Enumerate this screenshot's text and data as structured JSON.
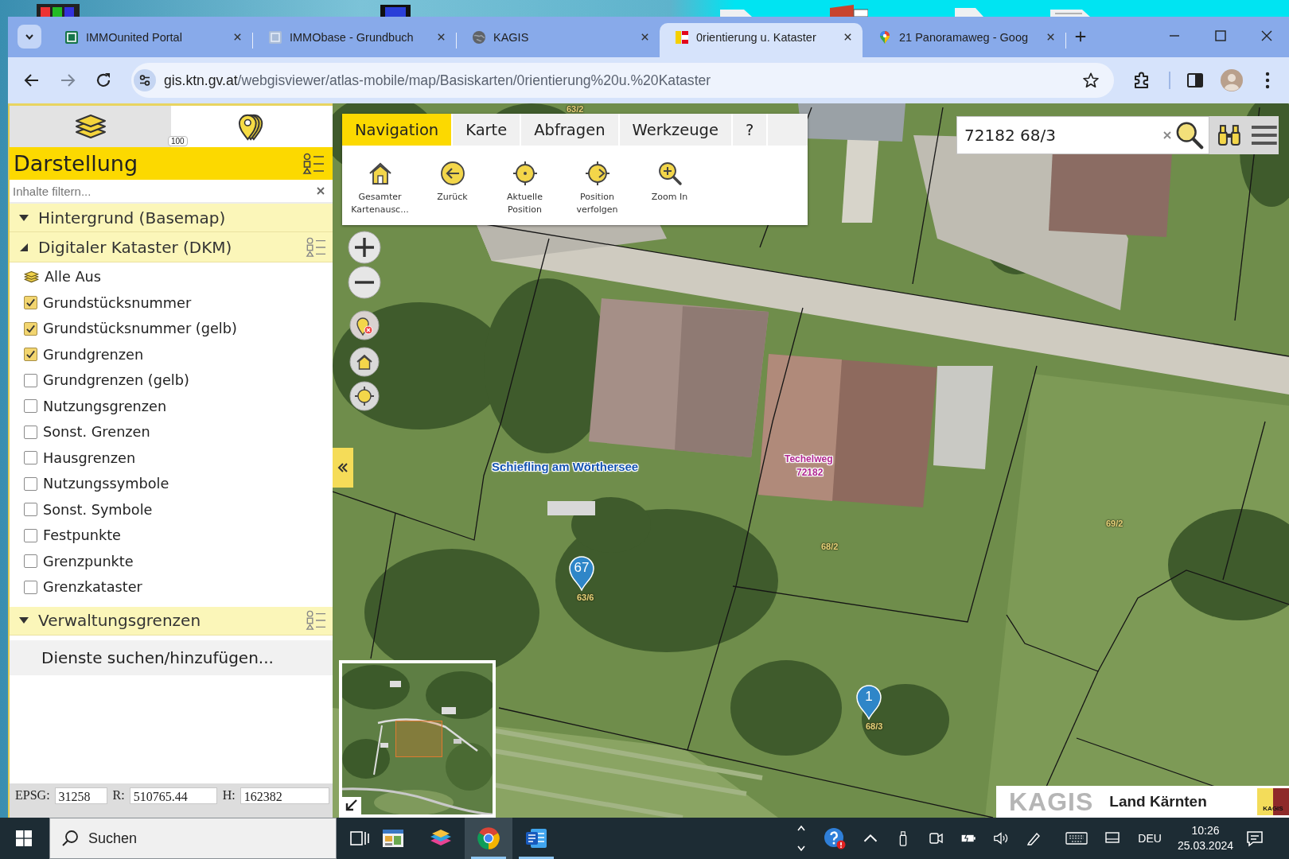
{
  "browser": {
    "tabs": [
      {
        "title": "IMMOunited Portal",
        "kind": "portal",
        "selected": false
      },
      {
        "title": "IMMObase - Grundbuch",
        "kind": "register",
        "selected": false
      },
      {
        "title": "KAGIS",
        "kind": "globe",
        "selected": false
      },
      {
        "title": "0rientierung u. Kataster",
        "kind": "flag",
        "selected": true
      },
      {
        "title": "21 Panoramaweg - Goog",
        "kind": "pin",
        "selected": false
      }
    ],
    "address": {
      "host": "gis.ktn.gv.at",
      "path": "/webgisviewer/atlas-mobile/map/Basiskarten/0rientierung%20u.%20Kataster"
    }
  },
  "sidebar": {
    "tabs": [
      {
        "kind": "layers",
        "selected": true
      },
      {
        "kind": "markers",
        "selected": false,
        "badge": "100"
      }
    ],
    "title": "Darstellung",
    "filter": {
      "placeholder": "Inhalte filtern..."
    },
    "groups": [
      {
        "title": "Hintergrund (Basemap)",
        "expanded": false,
        "legend": false
      },
      {
        "title": "Digitaler Kataster (DKM)",
        "expanded": true,
        "legend": true,
        "clear_all": "Alle Aus",
        "layers": [
          {
            "label": "Grundstücksnummer",
            "checked": true
          },
          {
            "label": "Grundstücksnummer (gelb)",
            "checked": true
          },
          {
            "label": "Grundgrenzen",
            "checked": true
          },
          {
            "label": "Grundgrenzen (gelb)",
            "checked": false
          },
          {
            "label": "Nutzungsgrenzen",
            "checked": false
          },
          {
            "label": "Sonst. Grenzen",
            "checked": false
          },
          {
            "label": "Hausgrenzen",
            "checked": false
          },
          {
            "label": "Nutzungssymbole",
            "checked": false
          },
          {
            "label": "Sonst. Symbole",
            "checked": false
          },
          {
            "label": "Festpunkte",
            "checked": false
          },
          {
            "label": "Grenzpunkte",
            "checked": false
          },
          {
            "label": "Grenzkataster",
            "checked": false
          }
        ]
      },
      {
        "title": "Verwaltungsgrenzen",
        "expanded": false,
        "legend": true
      }
    ],
    "add_services": "Dienste suchen/hinzufügen...",
    "coordinates": [
      {
        "label": "EPSG:",
        "value": "31258"
      },
      {
        "label": "R:",
        "value": "510765.44"
      },
      {
        "label": "H:",
        "value": "162382"
      }
    ]
  },
  "map": {
    "toolbar": {
      "tabs": [
        {
          "label": "Navigation",
          "selected": true
        },
        {
          "label": "Karte",
          "selected": false
        },
        {
          "label": "Abfragen",
          "selected": false
        },
        {
          "label": "Werkzeuge",
          "selected": false
        },
        {
          "label": "?",
          "selected": false
        }
      ],
      "tools": [
        {
          "label": "Gesamter Kartenausc...",
          "kind": "home"
        },
        {
          "label": "Zurück",
          "kind": "back"
        },
        {
          "label": "Aktuelle Position",
          "kind": "locate"
        },
        {
          "label": "Position verfolgen",
          "kind": "follow"
        },
        {
          "label": "Zoom In",
          "kind": "zoom"
        }
      ]
    },
    "search": {
      "value": "72182 68/3"
    },
    "labels": [
      {
        "text": "63/2",
        "kind": "parcel"
      },
      {
        "text": "Schiefling am Wörthersee",
        "kind": "place"
      },
      {
        "text": "Techelweg",
        "kind": "street"
      },
      {
        "text": "72182",
        "kind": "street"
      },
      {
        "text": "68/2",
        "kind": "parcel"
      },
      {
        "text": "69/2",
        "kind": "parcel"
      },
      {
        "text": "63/6",
        "kind": "parcel"
      },
      {
        "text": "68/3",
        "kind": "parcel"
      }
    ],
    "markers": [
      {
        "label": "67"
      },
      {
        "label": "1"
      }
    ],
    "logo": {
      "name": "KAGIS",
      "region": "Land Kärnten",
      "badge": "KAGIS"
    }
  },
  "taskbar": {
    "search": {
      "placeholder": "Suchen"
    },
    "apps": [
      {
        "kind": "viewer",
        "running": false,
        "selected": false
      },
      {
        "kind": "stack",
        "running": false,
        "selected": false
      },
      {
        "kind": "browser",
        "running": true,
        "selected": true
      },
      {
        "kind": "writer",
        "running": true,
        "selected": false
      }
    ],
    "language": "DEU",
    "time": "10:26",
    "date": "25.03.2024"
  }
}
